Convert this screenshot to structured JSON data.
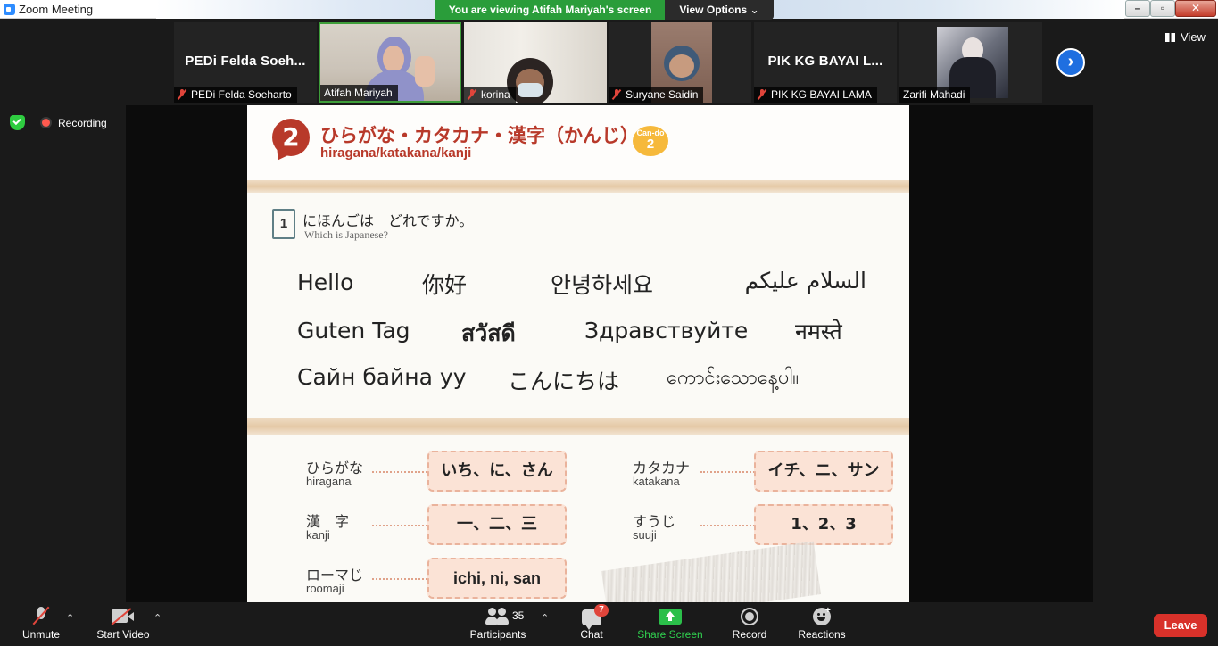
{
  "window": {
    "title": "Zoom Meeting"
  },
  "banner": {
    "viewing": "You are viewing Atifah Mariyah's screen",
    "view_options": "View Options"
  },
  "view_button": "View",
  "status": {
    "recording": "Recording"
  },
  "participants_strip": [
    {
      "name": "PEDi Felda Soeharto",
      "display_text": "PEDi Felda Soeh...",
      "muted": true,
      "video": false
    },
    {
      "name": "Atifah Mariyah",
      "muted": false,
      "video": true,
      "active": true
    },
    {
      "name": "korina",
      "muted": true,
      "video": true
    },
    {
      "name": "Suryane Saidin",
      "muted": true,
      "video": true
    },
    {
      "name": "PIK KG BAYAI LAMA",
      "display_text": "PIK KG BAYAI L...",
      "muted": true,
      "video": false
    },
    {
      "name": "Zarifi Mahadi",
      "muted": false,
      "video": true
    }
  ],
  "slide": {
    "section_number": "2",
    "section_title": "ひらがな・カタカナ・漢字（かんじ）",
    "section_subtitle": "hiragana/katakana/kanji",
    "cando_label": "Can-do",
    "cando_number": "2",
    "question_number": "1",
    "question_jp": "にほんごは　どれですか。",
    "question_en": "Which is Japanese?",
    "greetings": [
      "Hello",
      "你好",
      "안녕하세요",
      "السلام عليكم",
      "Guten Tag",
      "สวัสดี",
      "Здравствуйте",
      "नमस्ते",
      "Сайн байна уу",
      "こんにちは",
      "ကောင်းသောနေ့ပါ။"
    ],
    "scripts": [
      {
        "jp": "ひらがな",
        "romaji": "hiragana",
        "example": "いち、に、さん"
      },
      {
        "jp": "カタカナ",
        "romaji": "katakana",
        "example": "イチ、ニ、サン"
      },
      {
        "jp": "漢　字",
        "romaji": "kanji",
        "example": "一、二、三"
      },
      {
        "jp": "すうじ",
        "romaji": "suuji",
        "example": "1、2、3"
      },
      {
        "jp": "ローマじ",
        "romaji": "roomaji",
        "example": "ichi, ni, san"
      }
    ]
  },
  "toolbar": {
    "unmute": "Unmute",
    "start_video": "Start Video",
    "participants": "Participants",
    "participants_count": "35",
    "chat": "Chat",
    "chat_badge": "7",
    "share_screen": "Share Screen",
    "record": "Record",
    "reactions": "Reactions",
    "leave": "Leave"
  },
  "colors": {
    "accent_green": "#2a9d3a",
    "leave_red": "#d8312a",
    "slide_red": "#b8392a",
    "zoom_blue": "#2d8cff"
  }
}
